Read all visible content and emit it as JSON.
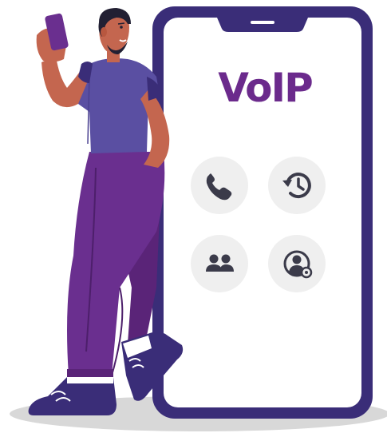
{
  "app": {
    "logo": "VoIP"
  },
  "colors": {
    "phone_frame": "#3a2d78",
    "screen": "#ffffff",
    "logo": "#6b2a8c",
    "button_bg": "#efefef",
    "icon": "#3b3b4a",
    "pants": "#6a2f8f",
    "shirt": "#5a4fa2",
    "skin": "#c4664f",
    "shoes": "#3a2d78",
    "shadow": "#d8d8d8"
  },
  "actions": [
    {
      "id": "call",
      "icon": "phone-icon"
    },
    {
      "id": "history",
      "icon": "history-icon"
    },
    {
      "id": "contacts",
      "icon": "contacts-icon"
    },
    {
      "id": "profile",
      "icon": "profile-settings-icon"
    }
  ]
}
